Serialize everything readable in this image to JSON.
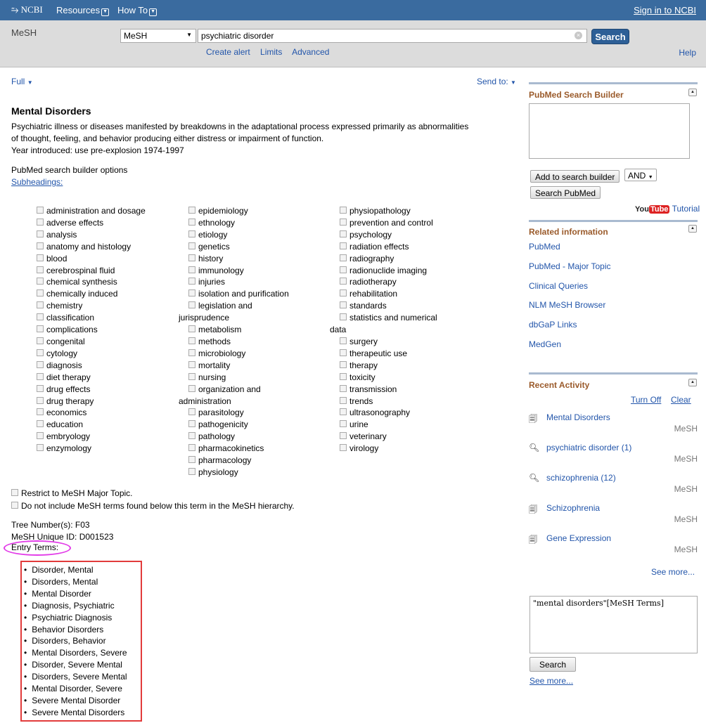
{
  "topbar": {
    "logo": "NCBI",
    "resources": "Resources",
    "howto": "How To",
    "signin": "Sign in to NCBI"
  },
  "search": {
    "db_label": "MeSH",
    "db_selected": "MeSH",
    "term": "psychiatric disorder",
    "button": "Search",
    "links": [
      "Create alert",
      "Limits",
      "Advanced"
    ],
    "help": "Help"
  },
  "main": {
    "full": "Full",
    "send_to": "Send to:",
    "title": "Mental Disorders",
    "description_1": "Psychiatric illness or diseases manifested by breakdowns in the adaptational process expressed primarily as abnormalities",
    "description_2": "of thought, feeling, and behavior producing either distress or impairment of function.",
    "year": "Year introduced: use pre-explosion 1974-1997",
    "options_label": "PubMed search builder options",
    "subheadings_label": "Subheadings:",
    "col1": [
      "administration and dosage",
      "adverse effects",
      "analysis",
      "anatomy and histology",
      "blood",
      "cerebrospinal fluid",
      "chemical synthesis",
      "chemically induced",
      "chemistry",
      "classification",
      "complications",
      "congenital",
      "cytology",
      "diagnosis",
      "diet therapy",
      "drug effects",
      "drug therapy",
      "economics",
      "education",
      "embryology",
      "enzymology"
    ],
    "col2": [
      "epidemiology",
      "ethnology",
      "etiology",
      "genetics",
      "history",
      "immunology",
      "injuries",
      "isolation and purification",
      "legislation and",
      "jurisprudence",
      "metabolism",
      "methods",
      "microbiology",
      "mortality",
      "nursing",
      "organization and",
      "administration",
      "parasitology",
      "pathogenicity",
      "pathology",
      "pharmacokinetics",
      "pharmacology",
      "physiology"
    ],
    "col3": [
      "physiopathology",
      "prevention and control",
      "psychology",
      "radiation effects",
      "radiography",
      "radionuclide imaging",
      "radiotherapy",
      "rehabilitation",
      "standards",
      "statistics and numerical",
      "data",
      "surgery",
      "therapeutic use",
      "therapy",
      "toxicity",
      "transmission",
      "trends",
      "ultrasonography",
      "urine",
      "veterinary",
      "virology"
    ],
    "restrict": "Restrict to MeSH Major Topic.",
    "no_below": "Do not include MeSH terms found below this term in the MeSH hierarchy.",
    "tree": "Tree Number(s): F03",
    "uid": "MeSH Unique ID: D001523",
    "entry_head": "Entry Terms:",
    "entry_terms": [
      "Disorder, Mental",
      "Disorders, Mental",
      "Mental Disorder",
      "Diagnosis, Psychiatric",
      "Psychiatric Diagnosis",
      "Behavior Disorders",
      "Disorders, Behavior",
      "Mental Disorders, Severe",
      "Disorder, Severe Mental",
      "Disorders, Severe Mental",
      "Mental Disorder, Severe",
      "Severe Mental Disorder",
      "Severe Mental Disorders"
    ]
  },
  "sidebar": {
    "builder_title": "PubMed Search Builder",
    "add_button": "Add to search builder",
    "and_option": "AND",
    "search_pubmed": "Search PubMed",
    "yt_you": "You",
    "yt_tube": "Tube",
    "tutorial": "Tutorial",
    "related_title": "Related information",
    "related": [
      "PubMed",
      "PubMed - Major Topic",
      "Clinical Queries",
      "NLM MeSH Browser",
      "dbGaP Links",
      "MedGen"
    ],
    "recent_title": "Recent Activity",
    "turn_off": "Turn Off",
    "clear": "Clear",
    "recent": [
      {
        "icon": "document-icon",
        "label": "Mental Disorders",
        "source": "MeSH"
      },
      {
        "icon": "magnifier-icon",
        "label": "psychiatric disorder (1)",
        "source": "MeSH"
      },
      {
        "icon": "magnifier-icon",
        "label": "schizophrenia (12)",
        "source": "MeSH"
      },
      {
        "icon": "document-icon",
        "label": "Schizophrenia",
        "source": "MeSH"
      },
      {
        "icon": "document-icon",
        "label": "Gene Expression",
        "source": "MeSH"
      }
    ],
    "see_more_1": "See more...",
    "query": "\"mental disorders\"[MeSH Terms]",
    "search_btn": "Search",
    "see_more_2": "See more..."
  }
}
